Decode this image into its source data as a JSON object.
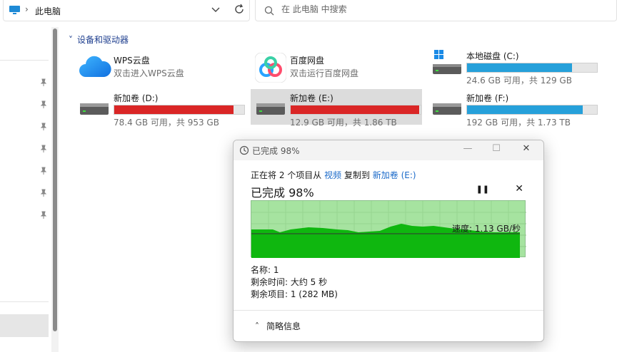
{
  "address": {
    "crumb": "此电脑"
  },
  "search": {
    "placeholder": "在 此电脑 中搜索"
  },
  "section": {
    "title": "设备和驱动器"
  },
  "drives": [
    {
      "name": "WPS云盘",
      "sub": "双击进入WPS云盘",
      "icon": "cloud-icon"
    },
    {
      "name": "百度网盘",
      "sub": "双击运行百度网盘",
      "icon": "baidu-netdisk-icon"
    },
    {
      "name": "本地磁盘 (C:)",
      "free": "24.6 GB 可用，共 129 GB",
      "used_fraction": 0.81,
      "bar_color": "#26a0da"
    },
    {
      "name": "新加卷 (D:)",
      "free": "78.4 GB 可用，共 953 GB",
      "used_fraction": 0.92,
      "bar_color": "#da2626"
    },
    {
      "name": "新加卷 (E:)",
      "free": "12.9 GB 可用，共 1.86 TB",
      "used_fraction": 0.99,
      "bar_color": "#da2626"
    },
    {
      "name": "新加卷 (F:)",
      "free": "192 GB 可用，共 1.73 TB",
      "used_fraction": 0.89,
      "bar_color": "#26a0da"
    }
  ],
  "dialog": {
    "title": "已完成 98%",
    "copy_prefix": "正在将 2 个项目从",
    "copy_source": "视频",
    "copy_middle": "复制到",
    "copy_dest": "新加卷 (E:)",
    "heading": "已完成 98%",
    "progress_percent": 98,
    "speed": "速度: 1.13 GB/秒",
    "name": "名称: 1",
    "time_left": "剩余时间: 大约 5 秒",
    "items_left": "剩余项目: 1 (282 MB)",
    "details": "简略信息"
  }
}
